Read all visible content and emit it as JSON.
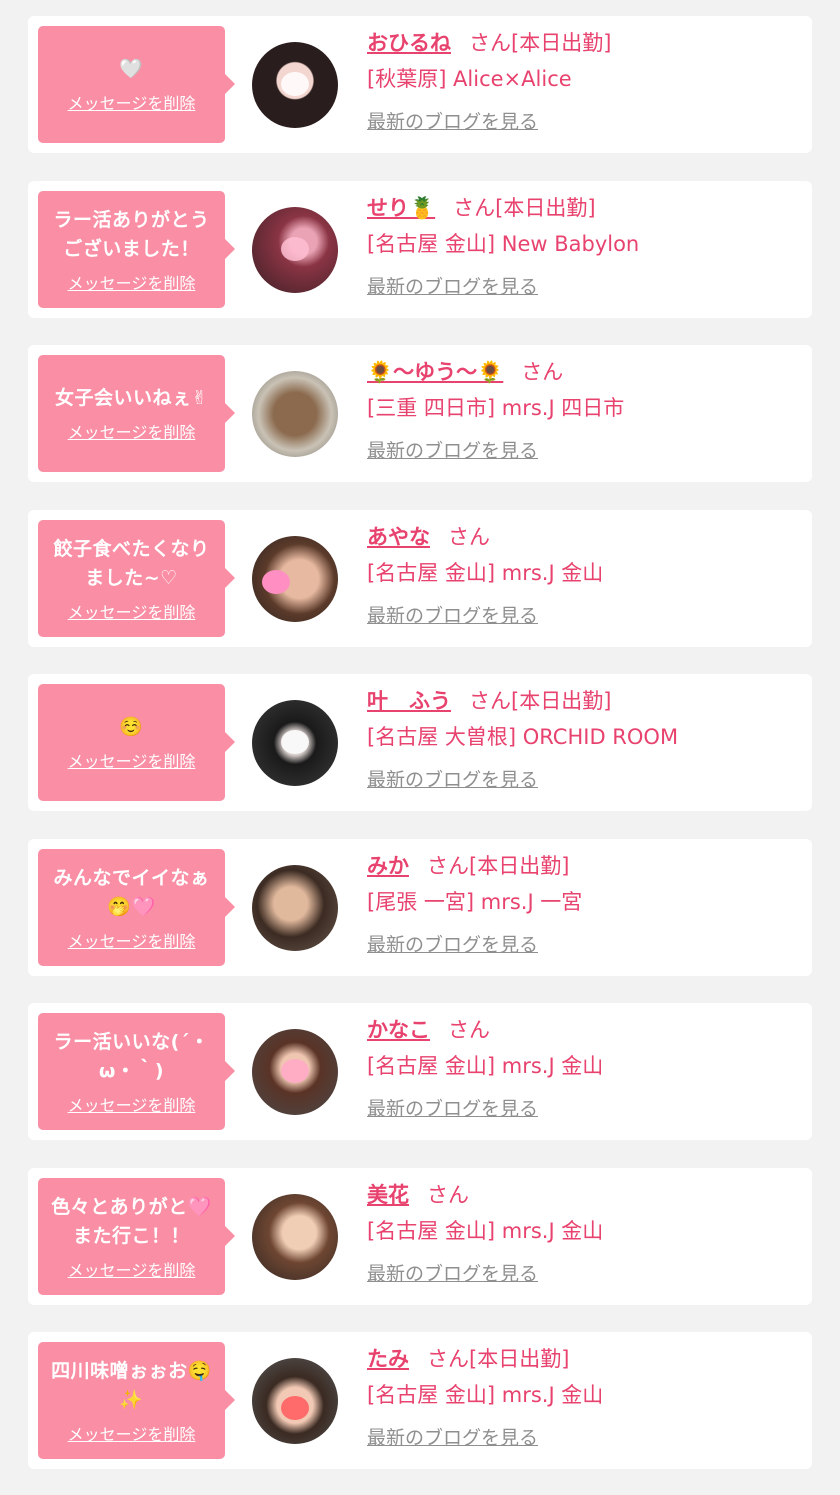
{
  "delete_label": "メッセージを削除",
  "blog_label": "最新のブログを見る",
  "san_label": "さん",
  "cards": [
    {
      "message": "🤍",
      "name": "おひるね",
      "status": "[本日出勤]",
      "shop": "[秋葉原] Alice×Alice"
    },
    {
      "message": "ラー活ありがとう\nございました！",
      "name": "せり🍍",
      "status": "[本日出勤]",
      "shop": "[名古屋 金山] New Babylon"
    },
    {
      "message": "女子会いいねぇ✌",
      "name": "🌻〜ゆう〜🌻",
      "status": "",
      "shop": "[三重 四日市] mrs.J 四日市"
    },
    {
      "message": "餃子食べたくなり\nました~♡",
      "name": "あやな",
      "status": "",
      "shop": "[名古屋 金山] mrs.J 金山"
    },
    {
      "message": "☺️",
      "name": "叶　ふう",
      "status": "[本日出勤]",
      "shop": "[名古屋 大曽根] ORCHID ROOM"
    },
    {
      "message": "みんなでイイなぁ\n🤭🩷",
      "name": "みか",
      "status": "[本日出勤]",
      "shop": "[尾張 一宮] mrs.J 一宮"
    },
    {
      "message": "ラー活いいな(´・\nω・｀)",
      "name": "かなこ",
      "status": "",
      "shop": "[名古屋 金山] mrs.J 金山"
    },
    {
      "message": "色々とありがと🩷\nまた行こ！！",
      "name": "美花",
      "status": "",
      "shop": "[名古屋 金山] mrs.J 金山"
    },
    {
      "message": "四川味噌ぉぉお🤤\n✨",
      "name": "たみ",
      "status": "[本日出勤]",
      "shop": "[名古屋 金山] mrs.J 金山"
    }
  ],
  "colors": {
    "bubble": "#f98ea4",
    "accent": "#e8426e",
    "link_gray": "#8f8f8f",
    "background": "#f2f2f2"
  }
}
